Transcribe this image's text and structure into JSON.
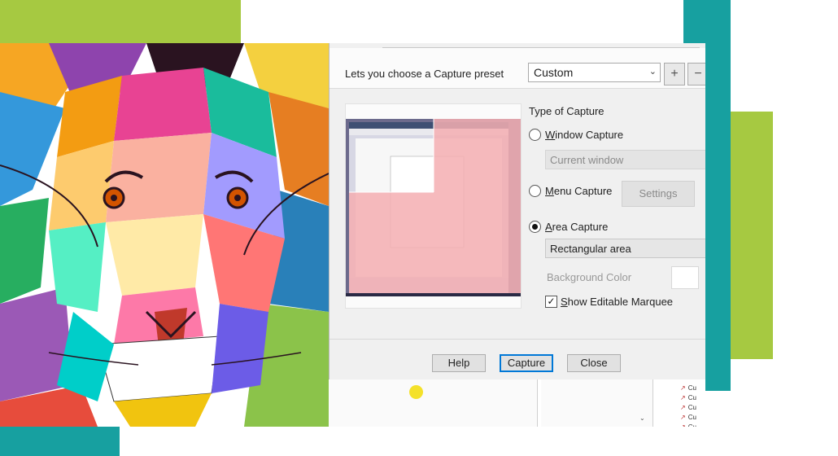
{
  "dialog": {
    "preset_label": "Lets you choose a Capture preset",
    "preset_value": "Custom",
    "add_label": "+",
    "remove_label": "−",
    "type_label": "Type of Capture",
    "window_capture": {
      "access": "W",
      "rest": "indow Capture",
      "selected": false
    },
    "window_target": "Current window",
    "menu_capture": {
      "access": "M",
      "rest": "enu Capture",
      "selected": false
    },
    "settings_label": "Settings",
    "area_capture": {
      "access": "A",
      "rest": "rea Capture",
      "selected": true
    },
    "area_type": "Rectangular area",
    "background_color_label": "Background Color",
    "show_marquee": {
      "access": "S",
      "rest": "how Editable Marquee",
      "checked": true
    },
    "help_label": "Help",
    "capture_label": "Capture",
    "close_label": "Close"
  },
  "background_list": [
    "Cu",
    "Cu",
    "Cu",
    "Cu",
    "Cu"
  ],
  "colors": {
    "brand_green": "#a6c941",
    "brand_teal": "#17a0a0",
    "selection_pink": "#f4aeb2",
    "focus_blue": "#0078d7"
  }
}
